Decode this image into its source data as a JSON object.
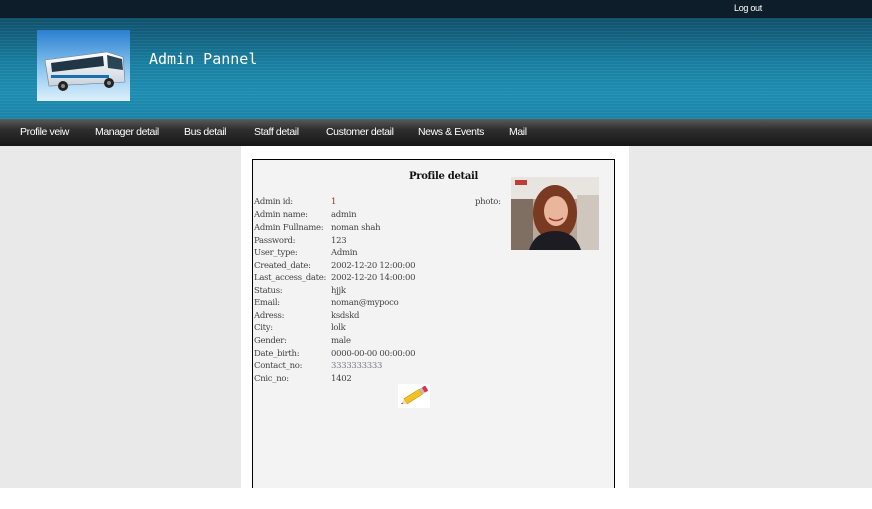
{
  "header": {
    "logout_label": "Log out",
    "site_title": "Admin Pannel"
  },
  "nav": {
    "items": [
      {
        "label": "Profile veiw"
      },
      {
        "label": "Manager detail"
      },
      {
        "label": "Bus detail"
      },
      {
        "label": "Staff detail"
      },
      {
        "label": "Customer detail"
      },
      {
        "label": "News & Events"
      },
      {
        "label": "Mail"
      }
    ]
  },
  "profile": {
    "title": "Profile detail",
    "photo_label": "photo:",
    "rows": [
      {
        "label": "Admin id:",
        "value": "1"
      },
      {
        "label": "Admin name:",
        "value": "admin"
      },
      {
        "label": "Admin Fullname:",
        "value": "noman shah"
      },
      {
        "label": "Password:",
        "value": "123"
      },
      {
        "label": "User_type:",
        "value": "Admin"
      },
      {
        "label": "Created_date:",
        "value": "2002-12-20 12:00:00"
      },
      {
        "label": "Last_access_date:",
        "value": "2002-12-20 14:00:00"
      },
      {
        "label": "Status:",
        "value": "hjjk"
      },
      {
        "label": "Email:",
        "value": "noman@mypoco"
      },
      {
        "label": "Adress:",
        "value": "ksdskd"
      },
      {
        "label": "City:",
        "value": "lolk"
      },
      {
        "label": "Gender:",
        "value": "male"
      },
      {
        "label": "Date_birth:",
        "value": "0000-00-00 00:00:00"
      },
      {
        "label": "Contact_no:",
        "value": "3333333333"
      },
      {
        "label": "Cnic_no:",
        "value": "1402"
      }
    ],
    "edit_icon": "pencil-icon"
  },
  "colors": {
    "topbar": "#0e1d2a",
    "banner": "#187ea0",
    "navbar": "#1e1e1e",
    "content_bg": "#e8e9e8"
  }
}
